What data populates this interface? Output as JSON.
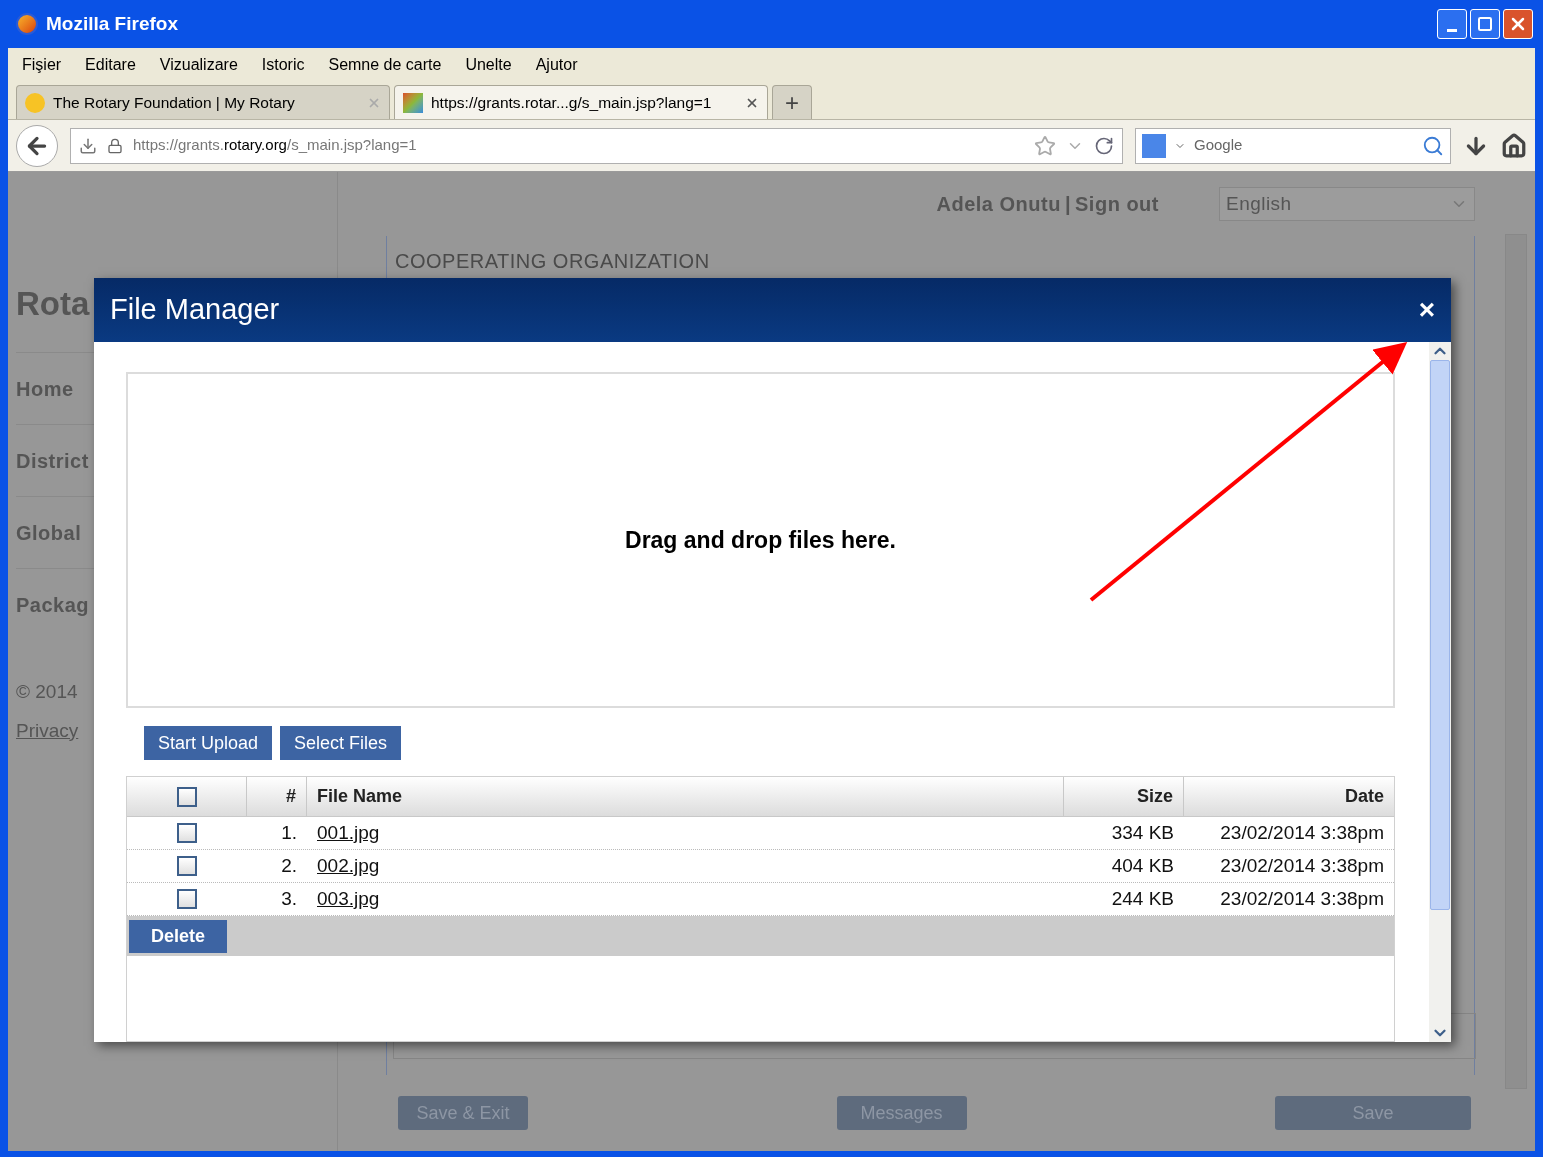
{
  "window": {
    "title": "Mozilla Firefox"
  },
  "menu": [
    "Fişier",
    "Editare",
    "Vizualizare",
    "Istoric",
    "Semne de carte",
    "Unelte",
    "Ajutor"
  ],
  "tabs": [
    {
      "title": "The Rotary Foundation | My Rotary",
      "selected": false
    },
    {
      "title": "https://grants.rotar...g/s_main.jsp?lang=1",
      "selected": true
    }
  ],
  "new_tab": "+",
  "address_bar": {
    "url": "https://grants.**rotary.org**/s_main.jsp?lang=1"
  },
  "search": {
    "placeholder": "Google"
  },
  "page": {
    "user": "Adela Onutu",
    "separator": "|",
    "sign_out": "Sign out",
    "language": "English",
    "brand": "Rota",
    "sidebar": [
      "Home",
      "District",
      "Global",
      "Packag"
    ],
    "copyright": "© 2014",
    "privacy": "Privacy",
    "heading": "COOPERATING ORGANIZATION",
    "buttons": [
      "Save & Exit",
      "Messages",
      "Save"
    ]
  },
  "dialog": {
    "title": "File Manager",
    "close": "×",
    "drop_text": "Drag and drop files here.",
    "buttons": [
      "Start Upload",
      "Select Files"
    ],
    "columns": [
      "#",
      "File Name",
      "Size",
      "Date"
    ],
    "header_checked": false,
    "rows": [
      {
        "number": "1.",
        "name": "001.jpg",
        "size": "334 KB",
        "date": "23/02/2014 3:38pm",
        "checked": false
      },
      {
        "number": "2.",
        "name": "002.jpg",
        "size": "404 KB",
        "date": "23/02/2014 3:38pm",
        "checked": false
      },
      {
        "number": "3.",
        "name": "003.jpg",
        "size": "244 KB",
        "date": "23/02/2014 3:38pm",
        "checked": false
      }
    ],
    "delete": "Delete"
  }
}
